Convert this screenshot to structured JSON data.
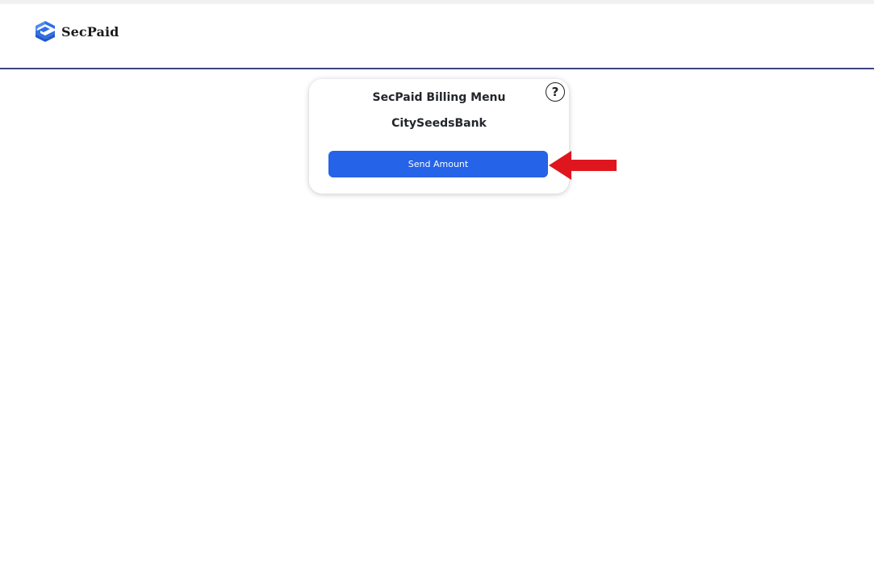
{
  "header": {
    "brand_name": "SecPaid",
    "brand_logo_icon": "secpaid-logo-icon",
    "accent_color": "#3f4481"
  },
  "card": {
    "title": "SecPaid Billing Menu",
    "subtitle": "CitySeedsBank",
    "help_label": "?",
    "help_icon": "question-circle-icon",
    "send_button_label": "Send Amount",
    "button_color": "#2563e8"
  },
  "annotation": {
    "pointer_icon": "red-arrow-icon",
    "color": "#e0161e"
  }
}
